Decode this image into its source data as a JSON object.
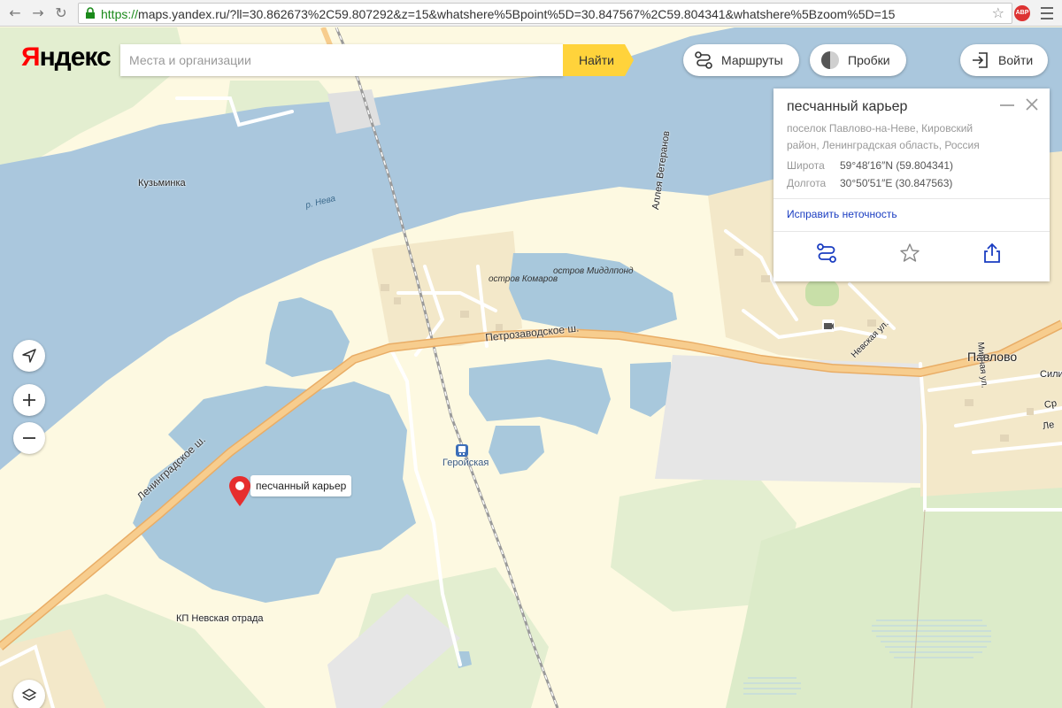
{
  "browser": {
    "url_scheme": "https://",
    "url_rest": "maps.yandex.ru/?ll=30.862673%2C59.807292&z=15&whatshere%5Bpoint%5D=30.847567%2C59.804341&whatshere%5Bzoom%5D=15",
    "ext_label": "ABP"
  },
  "header": {
    "logo_first": "Я",
    "logo_rest": "ндекс",
    "search_placeholder": "Места и организации",
    "search_button": "Найти",
    "routes_label": "Маршруты",
    "traffic_label": "Пробки",
    "login_label": "Войти"
  },
  "card": {
    "title": "песчанный карьер",
    "address": "поселок Павлово-на-Неве, Кировский район, Ленинградская область, Россия",
    "lat_label": "Широта",
    "lat_value": "59°48′16″N (59.804341)",
    "lon_label": "Долгота",
    "lon_value": "30°50′51″E (30.847563)",
    "fix_link": "Исправить неточность"
  },
  "map_labels": {
    "kuzminka": "Кузьминка",
    "neva": "р. Нева",
    "komarov": "остров Комаров",
    "middlpond": "остров Миддлпонд",
    "petrozavodskoe": "Петрозаводское ш.",
    "leningradskoe": "Ленинградское ш.",
    "alley": "Аллея Ветеранов",
    "pavlovo": "Павлово",
    "nevskaya": "Невская ул.",
    "mirnaya": "Мирная ул.",
    "geroyskaya": "Геройская",
    "kp": "КП Невская отрада",
    "sili": "Сили",
    "sr": "Ср",
    "le": "Ле"
  },
  "pin": {
    "label": "песчанный карьер"
  },
  "colors": {
    "land": "#fdf9e1",
    "water": "#a8c8dc",
    "river": "#aac7dd",
    "forest": "#dfeccd",
    "road_main": "#f6c88a",
    "accent": "#ffd33b",
    "pin": "#e62e2e",
    "link": "#1a3dc1"
  },
  "icons": {
    "routes": "routes-icon",
    "traffic": "traffic-icon",
    "login": "login-icon",
    "locate": "locate-icon",
    "zoom_in": "plus-icon",
    "zoom_out": "minus-icon",
    "layers": "layers-icon",
    "star": "star-icon",
    "share": "share-icon",
    "close": "close-icon",
    "minimize": "minimize-icon",
    "pin": "map-pin-icon"
  }
}
